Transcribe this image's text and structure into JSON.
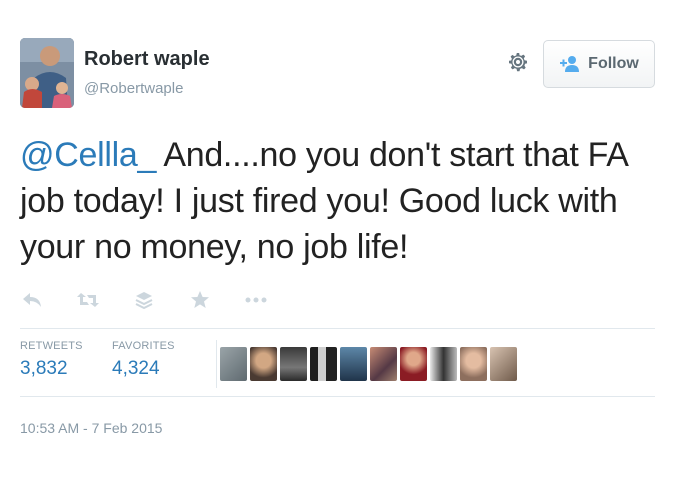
{
  "user": {
    "name": "Robert waple",
    "handle": "@Robertwaple"
  },
  "header": {
    "follow_label": "Follow",
    "icons": [
      "gear-icon",
      "add-user-icon"
    ]
  },
  "tweet": {
    "mention": "@Cellla_",
    "body": " And....no you don't start that FA job today!  I just fired you!  Good luck with your no money, no job life!"
  },
  "actions": [
    {
      "name": "reply",
      "icon": "reply-icon"
    },
    {
      "name": "retweet",
      "icon": "retweet-icon"
    },
    {
      "name": "stack",
      "icon": "stack-icon"
    },
    {
      "name": "favorite",
      "icon": "star-icon"
    },
    {
      "name": "more",
      "icon": "more-icon"
    }
  ],
  "stats": {
    "retweets_label": "RETWEETS",
    "retweets_value": "3,832",
    "favorites_label": "FAVORITES",
    "favorites_value": "4,324"
  },
  "favoriters_count_shown": 10,
  "timestamp": "10:53 AM - 7 Feb 2015",
  "colors": {
    "link": "#2b7bb9",
    "muted": "#8899a6",
    "text": "#222222",
    "divider": "#e1e8ed"
  }
}
